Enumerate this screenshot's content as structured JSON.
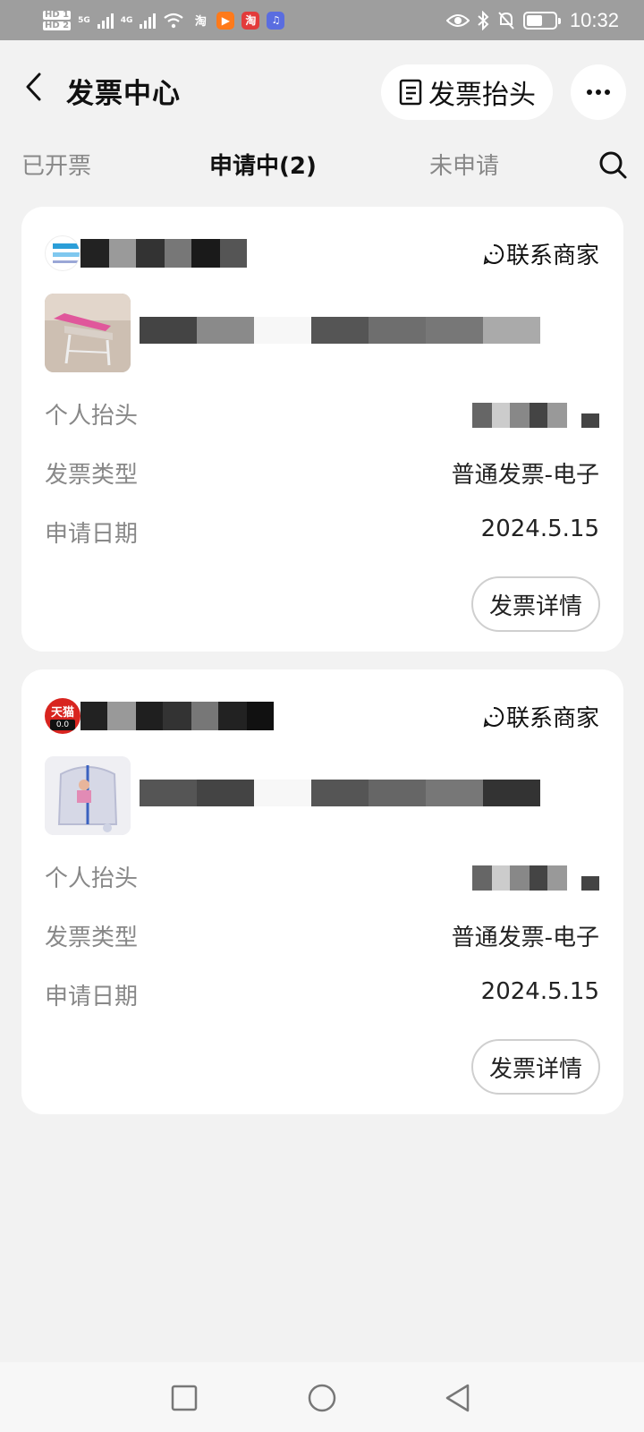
{
  "status_bar": {
    "time": "10:32",
    "network_1": "5G",
    "network_2": "4G",
    "hd_1": "HD 1",
    "hd_2": "HD 2",
    "battery_level": 0.55
  },
  "header": {
    "title": "发票中心",
    "invoice_header_button": "发票抬头"
  },
  "tabs": [
    {
      "label": "已开票",
      "active": false
    },
    {
      "label": "申请中(2)",
      "active": true
    },
    {
      "label": "未申请",
      "active": false
    }
  ],
  "orders": [
    {
      "contact_label": "联系商家",
      "rows": [
        {
          "label": "个人抬头",
          "value": ""
        },
        {
          "label": "发票类型",
          "value": "普通发票-电子"
        },
        {
          "label": "申请日期",
          "value": "2024.5.15"
        }
      ],
      "detail_button": "发票详情"
    },
    {
      "store_badge_top": "天猫",
      "store_badge_bottom": "0.0",
      "contact_label": "联系商家",
      "rows": [
        {
          "label": "个人抬头",
          "value": ""
        },
        {
          "label": "发票类型",
          "value": "普通发票-电子"
        },
        {
          "label": "申请日期",
          "value": "2024.5.15"
        }
      ],
      "detail_button": "发票详情"
    }
  ],
  "colors": {
    "background": "#f2f2f2",
    "card": "#ffffff",
    "status_bar": "#9e9e9e",
    "muted_text": "#888888"
  }
}
